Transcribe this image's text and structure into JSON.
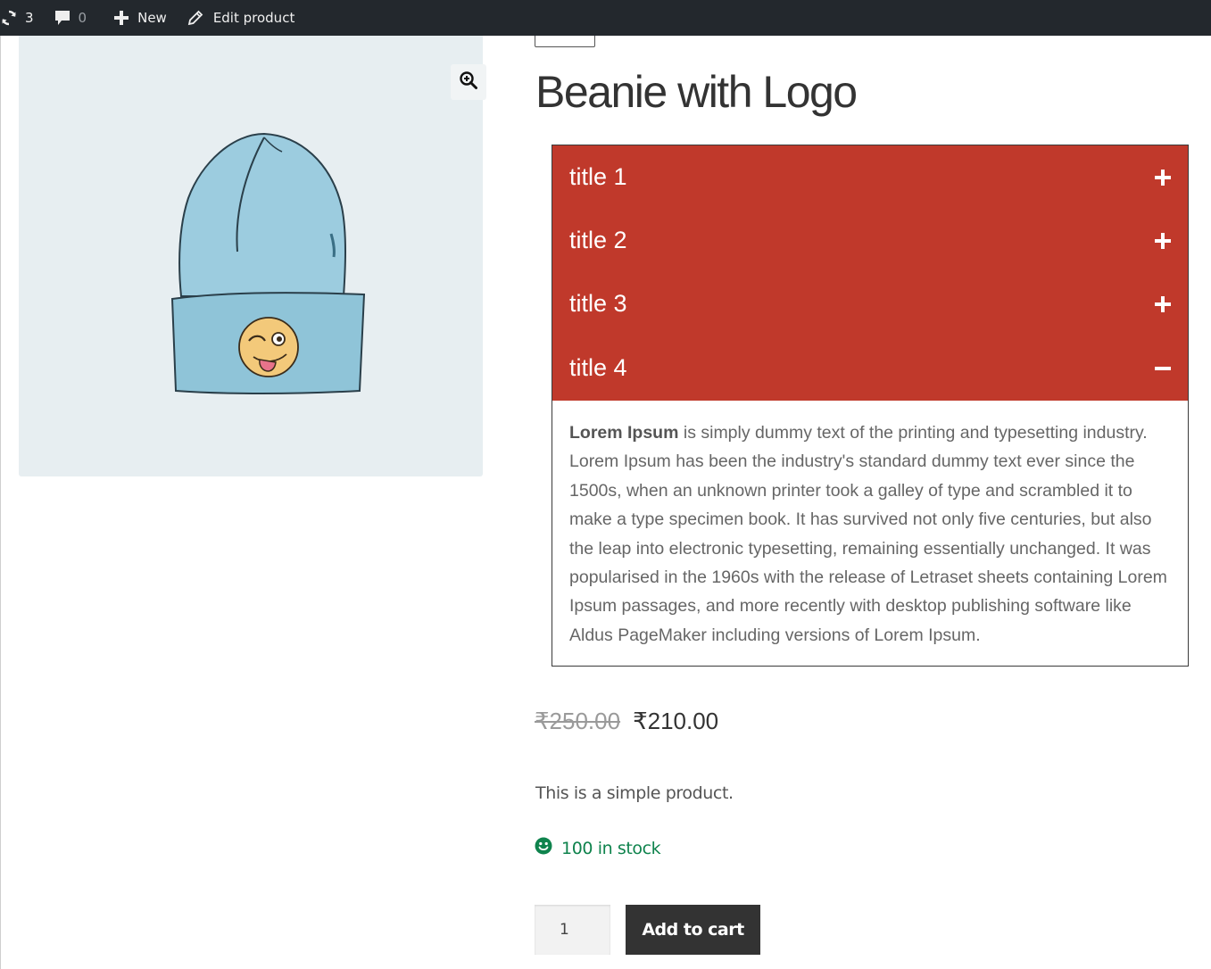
{
  "admin_bar": {
    "updates_count": "3",
    "comments_count": "0",
    "new_label": "New",
    "edit_label": "Edit product"
  },
  "product": {
    "title": "Beanie with Logo",
    "regular_price": "₹250.00",
    "sale_price": "₹210.00",
    "short_description": "This is a simple product.",
    "stock_status": "100 in stock",
    "quantity": "1",
    "add_to_cart_label": "Add to cart"
  },
  "accordion": {
    "items": [
      {
        "title": "title 1",
        "state": "collapsed"
      },
      {
        "title": "title 2",
        "state": "collapsed"
      },
      {
        "title": "title 3",
        "state": "collapsed"
      },
      {
        "title": "title 4",
        "state": "expanded"
      }
    ],
    "body_lead": "Lorem Ipsum",
    "body_text": " is simply dummy text of the printing and typesetting industry. Lorem Ipsum has been the industry's standard dummy text ever since the 1500s, when an unknown printer took a galley of type and scrambled it to make a type specimen book. It has survived not only five centuries, but also the leap into electronic typesetting, remaining essentially unchanged. It was popularised in the 1960s with the release of Letraset sheets containing Lorem Ipsum passages, and more recently with desktop publishing software like Aldus PageMaker including versions of Lorem Ipsum."
  },
  "colors": {
    "admin_bar": "#23282d",
    "accordion_header": "#c0392b",
    "stock": "#0f834d",
    "button": "#333333"
  },
  "icons": [
    "refresh-icon",
    "comment-icon",
    "plus-icon",
    "pencil-icon",
    "zoom-icon",
    "expand-plus-icon",
    "collapse-minus-icon",
    "smiley-icon"
  ]
}
